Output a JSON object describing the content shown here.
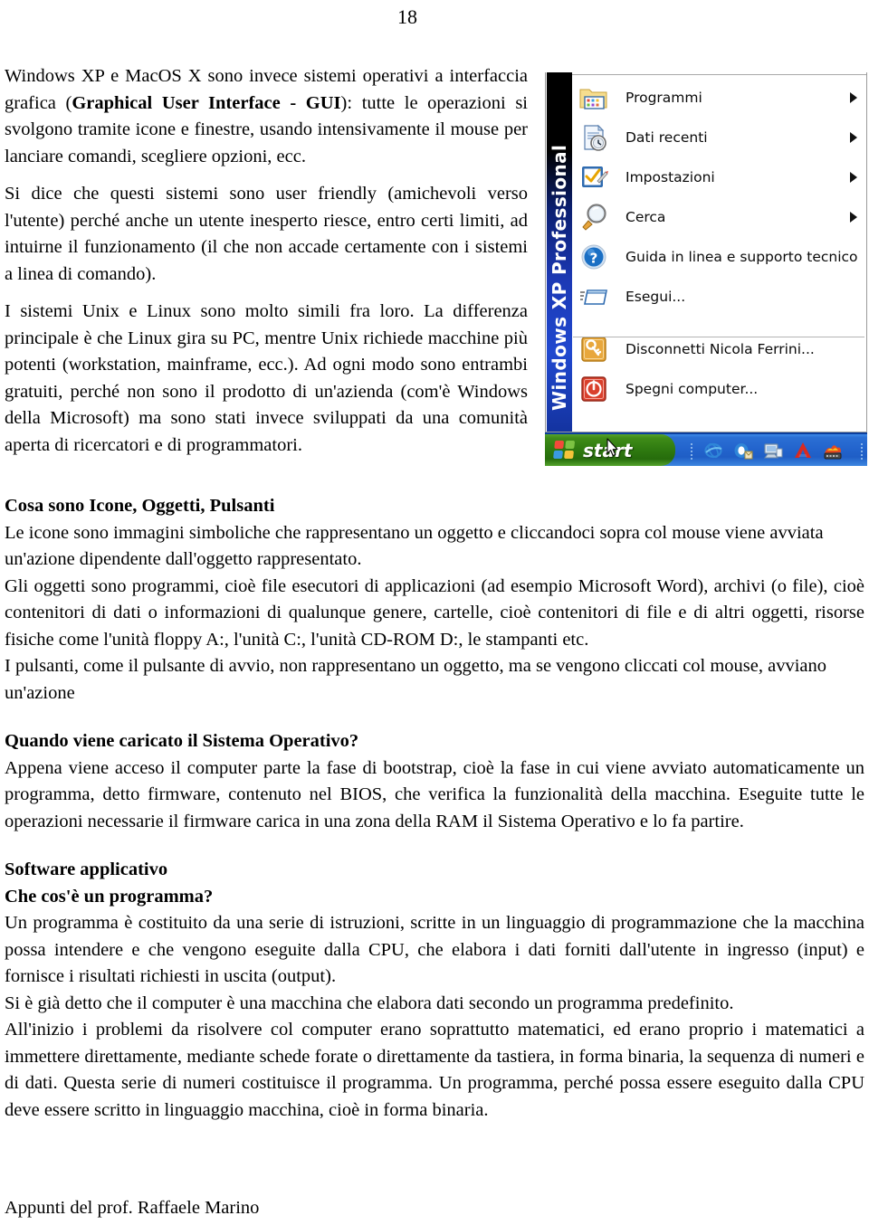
{
  "page": {
    "number": "18",
    "footer": "Appunti del prof. Raffaele Marino"
  },
  "intro": {
    "para1_a": "Windows XP e MacOS X sono invece sistemi operativi a interfaccia grafica (",
    "para1_bold": "Graphical User Interface - GUI",
    "para1_b": "): tutte le operazioni si svolgono tramite icone e finestre, usando intensivamente il mouse per lanciare comandi, scegliere opzioni, ecc.",
    "para2": "Si dice che questi sistemi sono user friendly (amichevoli verso l'utente) perché anche un utente inesperto riesce, entro certi limiti, ad intuirne il funzionamento (il che non accade certamente con i sistemi a linea di comando).",
    "para3": "I sistemi Unix e Linux sono molto simili fra loro. La differenza principale è che Linux gira su PC, mentre Unix richiede macchine più potenti (workstation, mainframe, ecc.). Ad ogni modo sono entrambi gratuiti, perché non sono il prodotto di un'azienda (com'è Windows della Microsoft) ma sono stati invece sviluppati da una comunità aperta di ricercatori e di programmatori."
  },
  "xp_screenshot": {
    "sidebar_brand": "Windows XP Professional",
    "menu_items": [
      {
        "label": "Programmi",
        "icon": "programs-folder-icon",
        "has_submenu": true
      },
      {
        "label": "Dati recenti",
        "icon": "recent-documents-icon",
        "has_submenu": true
      },
      {
        "label": "Impostazioni",
        "icon": "settings-icon",
        "has_submenu": true
      },
      {
        "label": "Cerca",
        "icon": "search-magnifier-icon",
        "has_submenu": true
      },
      {
        "label": "Guida in linea e supporto tecnico",
        "icon": "help-question-icon",
        "has_submenu": false
      },
      {
        "label": "Esegui...",
        "icon": "run-window-icon",
        "has_submenu": false
      },
      {
        "label": "Disconnetti Nicola Ferrini...",
        "icon": "logoff-key-icon",
        "has_submenu": false
      },
      {
        "label": "Spegni computer...",
        "icon": "shutdown-power-icon",
        "has_submenu": false
      }
    ],
    "taskbar": {
      "start_label": "start",
      "quick_launch": [
        "internet-explorer-icon",
        "outlook-express-icon",
        "show-desktop-icon",
        "adobe-acrobat-icon",
        "nero-burning-icon"
      ]
    },
    "colors": {
      "taskbar_blue": "#2364cd",
      "start_green": "#2f7a10",
      "sidebar_blue": "#1c39b5"
    }
  },
  "sections": [
    {
      "heading": "Cosa sono Icone, Oggetti, Pulsanti",
      "paragraphs": [
        "Le icone sono immagini simboliche che rappresentano un oggetto e cliccandoci sopra col mouse viene avviata un'azione dipendente dall'oggetto rappresentato.",
        "Gli oggetti sono programmi, cioè file esecutori di applicazioni (ad esempio Microsoft Word), archivi (o file), cioè contenitori di dati o informazioni di qualunque genere, cartelle, cioè contenitori di file e di altri oggetti, risorse fisiche come l'unità floppy A:, l'unità C:, l'unità CD-ROM D:, le stampanti etc.",
        "I pulsanti, come il pulsante di avvio, non rappresentano un oggetto, ma se vengono cliccati col mouse, avviano un'azione"
      ]
    },
    {
      "heading": "Quando viene caricato il Sistema Operativo?",
      "paragraphs": [
        "Appena viene acceso il computer parte la fase di bootstrap, cioè la fase in cui viene avviato automaticamente un programma, detto firmware, contenuto nel BIOS, che verifica la funzionalità della macchina. Eseguite tutte le operazioni necessarie il firmware carica in una zona della RAM il Sistema Operativo e lo fa partire."
      ]
    },
    {
      "heading": "Software applicativo",
      "heading2": "Che cos'è un programma?",
      "paragraphs": [
        "Un programma è costituito da una serie di istruzioni, scritte in un linguaggio di programmazione che la macchina possa intendere e che vengono eseguite dalla CPU, che elabora i dati forniti dall'utente in ingresso (input) e fornisce i risultati richiesti in uscita (output).",
        "Si è già detto che il computer è una macchina che elabora dati secondo un programma predefinito.",
        "All'inizio i problemi da risolvere col computer erano soprattutto matematici, ed erano proprio i matematici a immettere direttamente, mediante schede forate o direttamente da tastiera, in forma binaria, la sequenza di numeri e di dati. Questa serie di numeri costituisce il programma. Un programma, perché possa essere eseguito dalla CPU deve essere scritto in linguaggio macchina, cioè in forma binaria."
      ]
    }
  ]
}
